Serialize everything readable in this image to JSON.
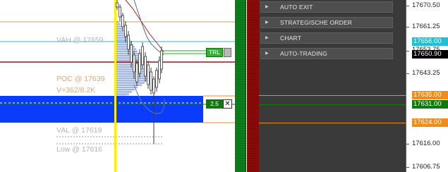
{
  "colors": {
    "vah_line": "#1fc0d6",
    "poc_line": "#8b1a1a",
    "order_zone": "#0a3cff",
    "sl_line": "#f08c1a",
    "target_line": "#0e7a0e",
    "volume_profile": "#9fb4de",
    "candle_line": "#5a5a5a",
    "highlight_column": "#fff200",
    "depth_green": "#0a7f1c",
    "depth_red": "#8a0a0a",
    "panel_bg": "#3a3a3a",
    "menu_bg": "#4e4e4e"
  },
  "chart": {
    "vah_label": "VAH @ 17659",
    "poc_label": "POC @ 17639",
    "volume_label": "V=362/8.2K",
    "val_label": "VAL @ 17619",
    "low_label": "Low @ 17616",
    "trl_button": "TRL",
    "quantity_badge": "2.5",
    "close_order_icon": "close-x-icon"
  },
  "panel": {
    "menu_items": [
      {
        "label": "AUTO EXIT",
        "icon": "triangle-right-icon"
      },
      {
        "label": "STRATEGISCHE ORDER",
        "icon": "triangle-right-icon"
      },
      {
        "label": "CHART",
        "icon": "triangle-right-icon"
      },
      {
        "label": "AUTO-TRADING",
        "icon": "triangle-right-icon"
      }
    ]
  },
  "axis": {
    "ticks": [
      "17670.50",
      "17661.25",
      "17653.75",
      "17643.25",
      "17616.00",
      "17606.75"
    ],
    "price_tags": [
      {
        "label": "17656.00",
        "bg": "#1fc0d6",
        "fg": "#ffffff"
      },
      {
        "label": "17650.90",
        "bg": "#000000",
        "fg": "#ffffff"
      },
      {
        "label": "17635.00",
        "bg": "#f08c1a",
        "fg": "#ffffff"
      },
      {
        "label": "17631.00",
        "bg": "#0e7a0e",
        "fg": "#ffffff"
      },
      {
        "label": "17624.00",
        "bg": "#f08c1a",
        "fg": "#ffffff"
      }
    ]
  }
}
